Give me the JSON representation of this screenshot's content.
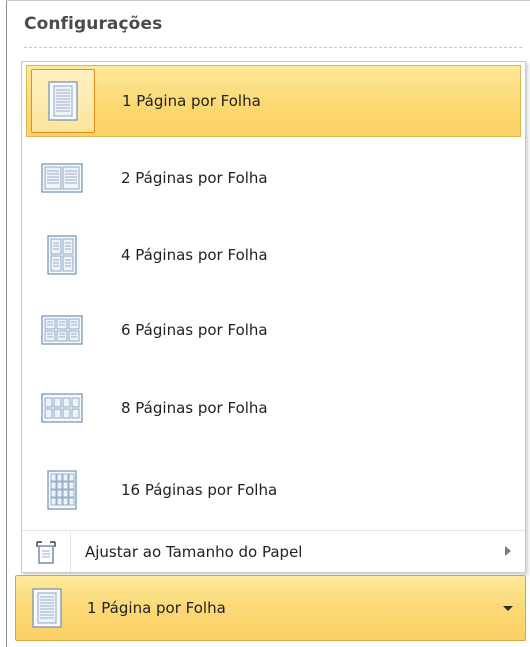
{
  "section": {
    "title": "Configurações"
  },
  "options": [
    {
      "label": "1 Página por Folha",
      "icon": "one-page-per-sheet-icon",
      "selected": true
    },
    {
      "label": "2 Páginas por Folha",
      "icon": "two-pages-per-sheet-icon",
      "selected": false
    },
    {
      "label": "4 Páginas por Folha",
      "icon": "four-pages-per-sheet-icon",
      "selected": false
    },
    {
      "label": "6 Páginas por Folha",
      "icon": "six-pages-per-sheet-icon",
      "selected": false
    },
    {
      "label": "8 Páginas por Folha",
      "icon": "eight-pages-per-sheet-icon",
      "selected": false
    },
    {
      "label": "16 Páginas por Folha",
      "icon": "sixteen-pages-per-sheet-icon",
      "selected": false
    }
  ],
  "fit": {
    "label": "Ajustar ao Tamanho do Papel",
    "icon": "scale-to-paper-icon",
    "submenu_icon": "chevron-right-icon"
  },
  "combo": {
    "label": "1 Página por Folha",
    "icon": "one-page-per-sheet-icon",
    "caret_icon": "dropdown-caret-icon"
  },
  "colors": {
    "selection_fill": "#fcd873",
    "selection_border": "#e88c1a",
    "icon_stroke": "#6f8fb4",
    "icon_fill": "#eef3fa"
  }
}
